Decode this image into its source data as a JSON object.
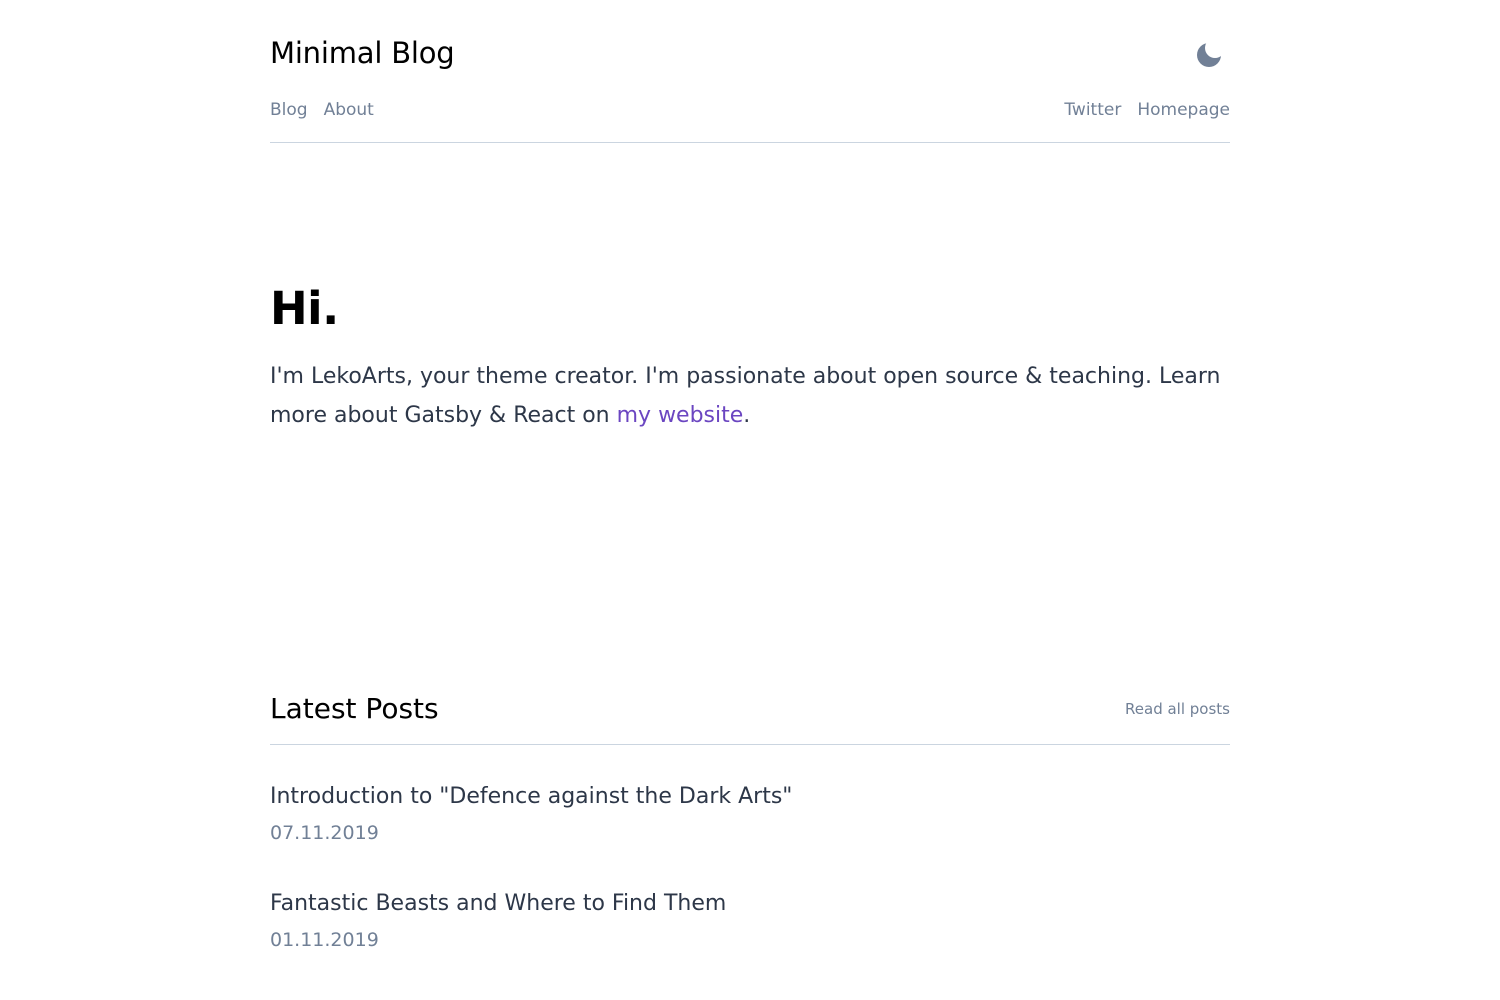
{
  "header": {
    "site_title": "Minimal Blog",
    "theme_toggle_icon": "moon-icon",
    "nav_left": [
      {
        "label": "Blog"
      },
      {
        "label": "About"
      }
    ],
    "nav_right": [
      {
        "label": "Twitter"
      },
      {
        "label": "Homepage"
      }
    ]
  },
  "hero": {
    "heading": "Hi.",
    "text_before_link": "I'm LekoArts, your theme creator. I'm passionate about open source & teaching. Learn more about Gatsby & React on ",
    "link_text": "my website",
    "text_after_link": "."
  },
  "latest_posts": {
    "title": "Latest Posts",
    "read_all_label": "Read all posts",
    "posts": [
      {
        "title": "Introduction to \"Defence against the Dark Arts\"",
        "date": "07.11.2019"
      },
      {
        "title": "Fantastic Beasts and Where to Find Them",
        "date": "01.11.2019"
      }
    ]
  },
  "colors": {
    "text": "#2d3748",
    "muted": "#718096",
    "link": "#6b46c1",
    "divider": "#cbd5e0",
    "heading": "#000000"
  }
}
